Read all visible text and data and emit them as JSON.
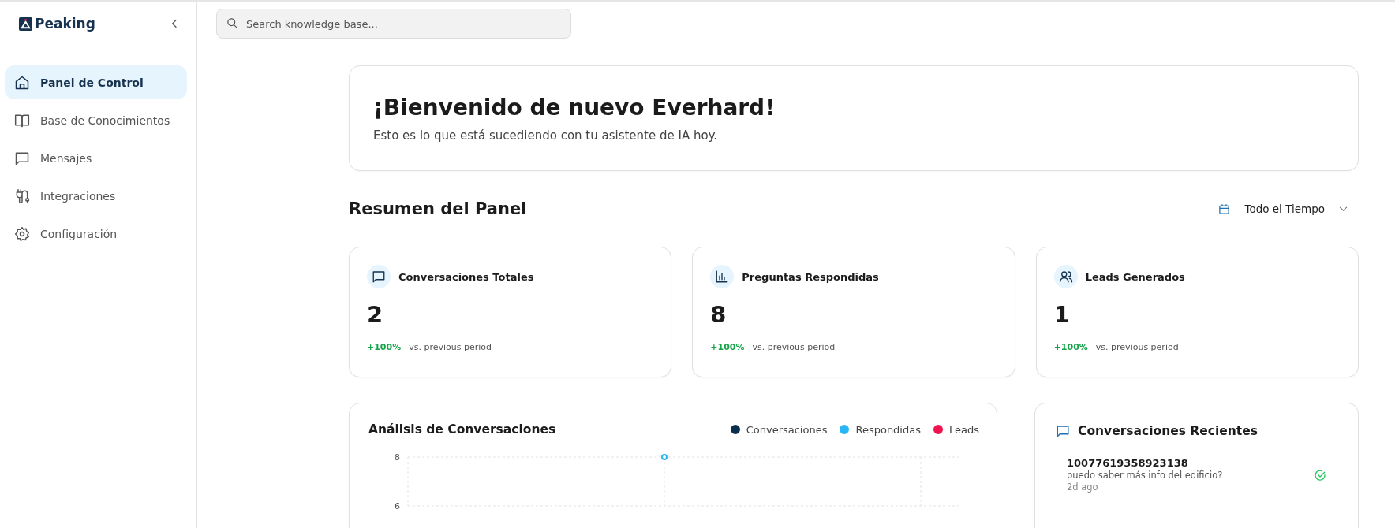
{
  "sidebar": {
    "logo": "Peaking",
    "items": [
      {
        "label": "Panel de Control",
        "kind": "home",
        "selected": true
      },
      {
        "label": "Base de Conocimientos",
        "kind": "book",
        "selected": false
      },
      {
        "label": "Mensajes",
        "kind": "message",
        "selected": false
      },
      {
        "label": "Integraciones",
        "kind": "plug",
        "selected": false
      },
      {
        "label": "Configuración",
        "kind": "gear",
        "selected": false
      }
    ]
  },
  "search": {
    "placeholder": "Search knowledge base..."
  },
  "welcome": {
    "title": "¡Bienvenido de nuevo Everhard!",
    "subtitle": "Esto es lo que está sucediendo con tu asistente de IA hoy."
  },
  "summary": {
    "title": "Resumen del Panel",
    "period": "Todo el Tiempo"
  },
  "stats": [
    {
      "label": "Conversaciones Totales",
      "kind": "message",
      "value": "2",
      "change": "+100%",
      "note": "vs. previous period"
    },
    {
      "label": "Preguntas Respondidas",
      "kind": "chart",
      "value": "8",
      "change": "+100%",
      "note": "vs. previous period"
    },
    {
      "label": "Leads Generados",
      "kind": "users",
      "value": "1",
      "change": "+100%",
      "note": "vs. previous period"
    }
  ],
  "analysis": {
    "title": "Análisis de Conversaciones",
    "chart_data": {
      "type": "line",
      "ylim": [
        6,
        8
      ],
      "yticks": [
        6,
        8
      ],
      "series": [
        {
          "name": "Conversaciones",
          "color": "#0d2f4f",
          "values": [
            null,
            null,
            null
          ]
        },
        {
          "name": "Respondidas",
          "color": "#29b6f6",
          "marker": "circle",
          "values": [
            null,
            8,
            null
          ]
        },
        {
          "name": "Leads",
          "color": "#f0134d",
          "values": [
            null,
            null,
            null
          ]
        }
      ]
    }
  },
  "recent": {
    "title": "Conversaciones Recientes",
    "items": [
      {
        "id": "10077619358923138",
        "message": "puedo saber más info del edificio?",
        "time": "2d ago",
        "resolved": true
      }
    ]
  }
}
